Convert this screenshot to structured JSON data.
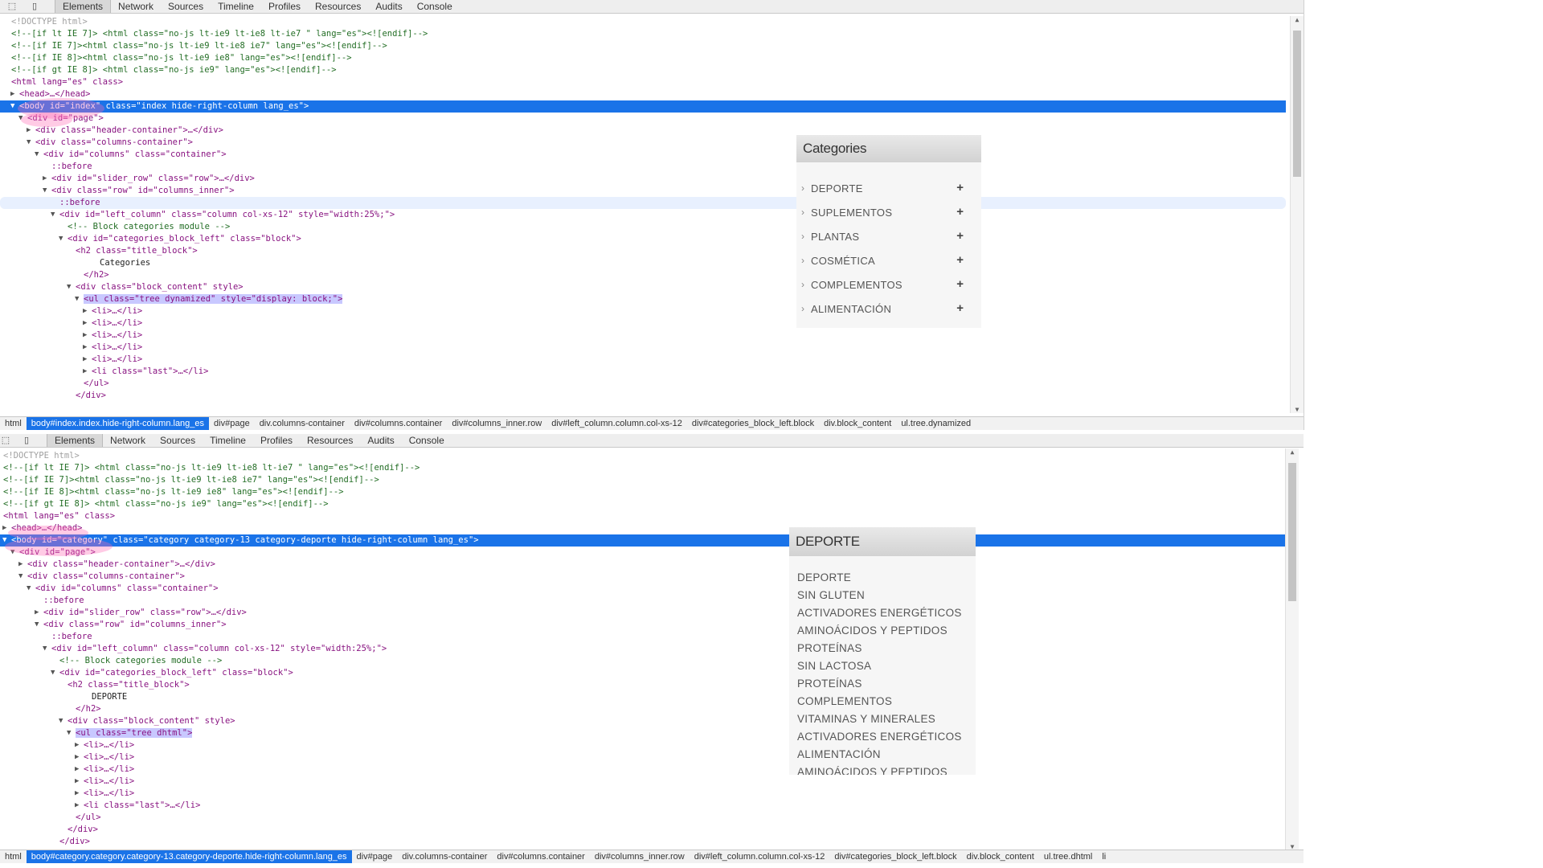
{
  "devtools_top": {
    "tabs": [
      "Elements",
      "Network",
      "Sources",
      "Timeline",
      "Profiles",
      "Resources",
      "Audits",
      "Console"
    ],
    "active_tab": "Elements",
    "lines": [
      "<!DOCTYPE html>",
      "<!--[if lt IE 7]> <html class=\"no-js lt-ie9 lt-ie8 lt-ie7 \" lang=\"es\"><![endif]-->",
      "<!--[if IE 7]><html class=\"no-js lt-ie9 lt-ie8 ie7\" lang=\"es\"><![endif]-->",
      "<!--[if IE 8]><html class=\"no-js lt-ie9 ie8\" lang=\"es\"><![endif]-->",
      "<!--[if gt IE 8]> <html class=\"no-js ie9\" lang=\"es\"><![endif]-->",
      "<html lang=\"es\" class>",
      "<head>…</head>",
      "<body id=\"index\" class=\"index hide-right-column lang_es\">",
      "<div id=\"page\">",
      "<div class=\"header-container\">…</div>",
      "<div class=\"columns-container\">",
      "<div id=\"columns\" class=\"container\">",
      "::before",
      "<div id=\"slider_row\" class=\"row\">…</div>",
      "<div class=\"row\" id=\"columns_inner\">",
      "::before",
      "<div id=\"left_column\" class=\"column col-xs-12\" style=\"width:25%;\">",
      "<!-- Block categories module -->",
      "<div id=\"categories_block_left\" class=\"block\">",
      "<h2 class=\"title_block\">",
      "Categories",
      "</h2>",
      "<div class=\"block_content\" style>",
      "<ul class=\"tree dynamized\" style=\"display: block;\">",
      "<li>…</li>",
      "<li>…</li>",
      "<li>…</li>",
      "<li>…</li>",
      "<li>…</li>",
      "<li class=\"last\">…</li>",
      "</ul>",
      "</div>"
    ],
    "breadcrumbs": [
      "html",
      "body#index.index.hide-right-column.lang_es",
      "div#page",
      "div.columns-container",
      "div#columns.container",
      "div#columns_inner.row",
      "div#left_column.column.col-xs-12",
      "div#categories_block_left.block",
      "div.block_content",
      "ul.tree.dynamized"
    ],
    "widget": {
      "title": "Categories",
      "items": [
        "DEPORTE",
        "SUPLEMENTOS",
        "PLANTAS",
        "COSMÉTICA",
        "COMPLEMENTOS",
        "ALIMENTACIÓN"
      ],
      "arrow_glyph": "›",
      "plus_glyph": "+"
    }
  },
  "devtools_bottom": {
    "tabs": [
      "Elements",
      "Network",
      "Sources",
      "Timeline",
      "Profiles",
      "Resources",
      "Audits",
      "Console"
    ],
    "active_tab": "Elements",
    "lines": [
      "<!DOCTYPE html>",
      "<!--[if lt IE 7]> <html class=\"no-js lt-ie9 lt-ie8 lt-ie7 \" lang=\"es\"><![endif]-->",
      "<!--[if IE 7]><html class=\"no-js lt-ie9 lt-ie8 ie7\" lang=\"es\"><![endif]-->",
      "<!--[if IE 8]><html class=\"no-js lt-ie9 ie8\" lang=\"es\"><![endif]-->",
      "<!--[if gt IE 8]> <html class=\"no-js ie9\" lang=\"es\"><![endif]-->",
      "<html lang=\"es\" class>",
      "<head>…</head>",
      "<body id=\"category\" class=\"category category-13 category-deporte hide-right-column lang_es\">",
      "<div id=\"page\">",
      "<div class=\"header-container\">…</div>",
      "<div class=\"columns-container\">",
      "<div id=\"columns\" class=\"container\">",
      "::before",
      "<div id=\"slider_row\" class=\"row\">…</div>",
      "<div class=\"row\" id=\"columns_inner\">",
      "::before",
      "<div id=\"left_column\" class=\"column col-xs-12\" style=\"width:25%;\">",
      "<!-- Block categories module -->",
      "<div id=\"categories_block_left\" class=\"block\">",
      "<h2 class=\"title_block\">",
      "DEPORTE",
      "</h2>",
      "<div class=\"block_content\" style>",
      "<ul class=\"tree dhtml\">",
      "<li>…</li>",
      "<li>…</li>",
      "<li>…</li>",
      "<li>…</li>",
      "<li>…</li>",
      "<li class=\"last\">…</li>",
      "</ul>",
      "</div>",
      "</div>"
    ],
    "breadcrumbs": [
      "html",
      "body#category.category.category-13.category-deporte.hide-right-column.lang_es",
      "div#page",
      "div.columns-container",
      "div#columns.container",
      "div#columns_inner.row",
      "div#left_column.column.col-xs-12",
      "div#categories_block_left.block",
      "div.block_content",
      "ul.tree.dhtml",
      "li"
    ],
    "widget": {
      "title": "DEPORTE",
      "items": [
        "DEPORTE",
        "SIN GLUTEN",
        "ACTIVADORES ENERGÉTICOS",
        "AMINOÁCIDOS Y PEPTIDOS",
        "PROTEÍNAS",
        "SIN LACTOSA",
        "PROTEÍNAS",
        "COMPLEMENTOS",
        "VITAMINAS Y MINERALES",
        "ACTIVADORES ENERGÉTICOS",
        "ALIMENTACIÓN",
        "AMINOÁCIDOS Y PEPTIDOS"
      ]
    }
  },
  "icons": [
    "inspect-icon",
    "device-icon"
  ],
  "colors": {
    "selection": "#1a73e8",
    "tag": "#881280",
    "attribute": "#994500",
    "value": "#1a1aa6",
    "comment": "#236e25"
  }
}
